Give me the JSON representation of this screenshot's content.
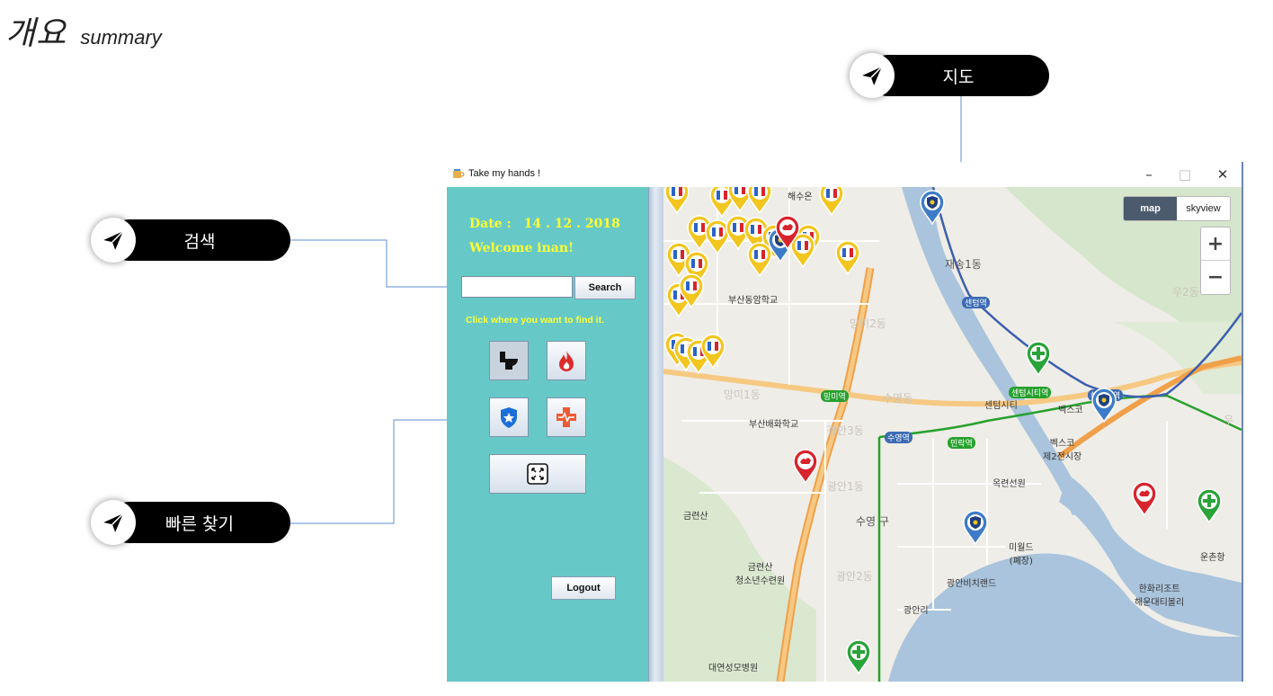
{
  "heading": {
    "title_ko": "개요",
    "title_en": "summary"
  },
  "callouts": {
    "map": "지도",
    "search": "검색",
    "quick": "빠른 찾기"
  },
  "window": {
    "title": "Take my hands !",
    "minimize": "–",
    "restore": "□",
    "close": "✕"
  },
  "panel": {
    "date_label": "Date :",
    "date_value": "14 . 12 . 2018",
    "welcome": "Welcome inan!",
    "search_value": "",
    "search_button": "Search",
    "hint": "Click where you want to find it.",
    "logout": "Logout",
    "quick_buttons": [
      "toilet-icon",
      "fire-icon",
      "police-badge-icon",
      "hospital-cross-icon",
      "expand-icon"
    ]
  },
  "map": {
    "type_map": "map",
    "type_sky": "skyview",
    "zoom_in": "+",
    "zoom_out": "−",
    "labels": {
      "school1": "부산동암학교",
      "school2": "부산배화학교",
      "dong_jaesong": "재송1동",
      "dong_mangmi1": "망미1동",
      "dong_mangmi2": "망미2동",
      "dong_suyeong": "수영동",
      "dong_gwangan3": "광안3동",
      "dong_gwangan1": "광안1동",
      "dong_gwangan2": "광안2동",
      "dong_u2": "우2동",
      "dong_u1": "우",
      "dong_haesu": "해수온",
      "gu_suyeong": "수영 구",
      "centum": "센텀시티",
      "bexco": "벡스코",
      "bexco_market": "벡스코\n제2전시장",
      "okryeon": "옥련선원",
      "miworld": "미월드\n(폐장)",
      "gwangan_land": "광안비치랜드",
      "gwangalli": "광안리",
      "geumryeonsan": "금련산",
      "youth_center": "금련산\n청소년수련원",
      "hanwha": "한화리조트\n해운대티볼리",
      "undong": "운촌항",
      "daeyeon_hospital": "대연성모병원",
      "st_suyeong": "수영역",
      "st_mangmi": "망미역",
      "st_centum": "센텀역",
      "st_centumcity": "센텀시티역",
      "st_minrak": "민락역",
      "st_haeundae": "해운대역"
    }
  },
  "colors": {
    "panel": "#67c9c7",
    "panel_text": "#ffff33",
    "callout": "#000000",
    "map_button_active": "#4b5a6d"
  }
}
